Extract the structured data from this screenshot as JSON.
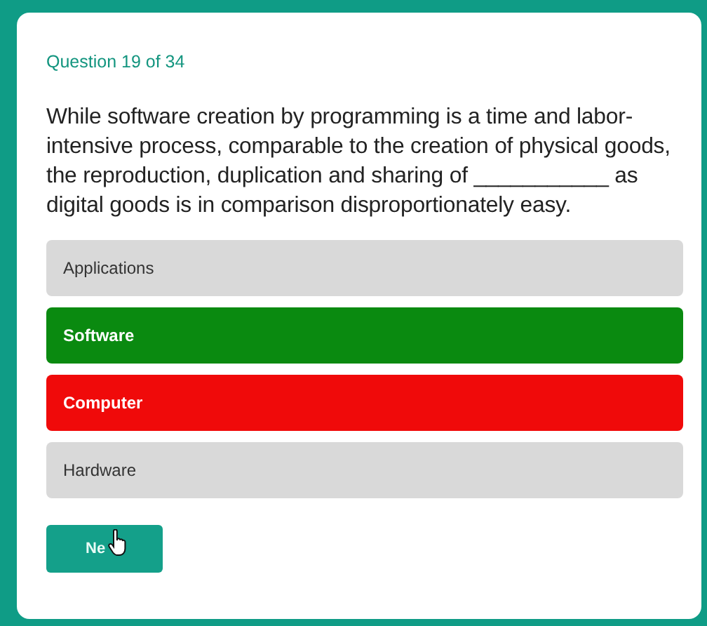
{
  "progress": "Question 19 of 34",
  "question": "While software creation by programming is a time and labor-intensive process, comparable to the creation of physical goods, the reproduction, duplication and sharing of ___________ as digital goods is in comparison disproportionately easy.",
  "options": [
    {
      "label": "Applications",
      "kind": "plain"
    },
    {
      "label": "Software",
      "kind": "correct"
    },
    {
      "label": "Computer",
      "kind": "wrong"
    },
    {
      "label": "Hardware",
      "kind": "plain"
    }
  ],
  "next_button": "Ne"
}
